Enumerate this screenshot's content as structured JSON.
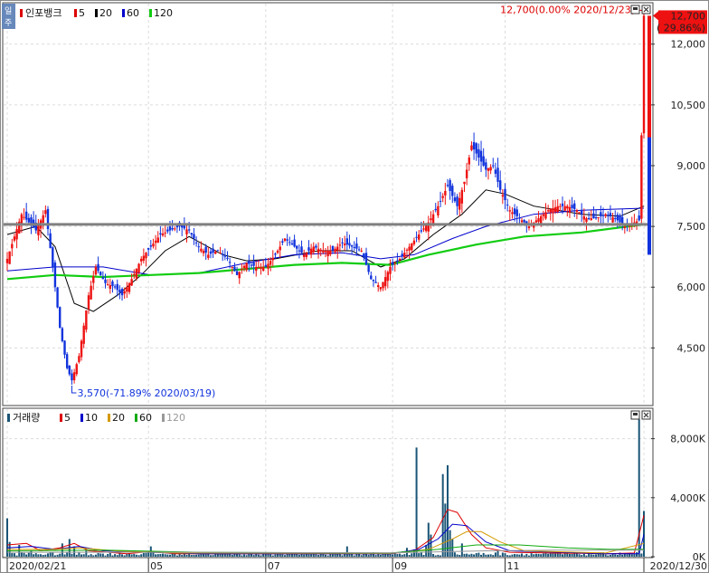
{
  "chart_data": [
    {
      "type": "candlestick",
      "legend": {
        "name": "인포뱅크",
        "items": [
          {
            "label": "5",
            "color": "#dd0000"
          },
          {
            "label": "20",
            "color": "#000000"
          },
          {
            "label": "60",
            "color": "#0000cc"
          },
          {
            "label": "120",
            "color": "#11cc11"
          }
        ]
      },
      "y_ticks": [
        "12,000",
        "10,500",
        "9,000",
        "7,500",
        "6,000",
        "4,500"
      ],
      "y_tick_values": [
        12000,
        10500,
        9000,
        7500,
        6000,
        4500
      ],
      "ylim": [
        3100,
        13000
      ],
      "reference_level": 7550,
      "last_price": {
        "price": "12,700",
        "change": "( 29.86%)",
        "value": 12700
      },
      "high_annotation": {
        "text": "12,700(0.00% 2020/12/23)",
        "value": 12700
      },
      "low_annotation": {
        "text": "3,570(-71.89% 2020/03/19)",
        "value": 3570
      },
      "right_bar": {
        "red": [
          7700,
          12700
        ],
        "blue": [
          6800,
          9700
        ]
      },
      "ohlc_path": [
        {
          "i": 0,
          "c": 6700
        },
        {
          "i": 6,
          "c": 7800
        },
        {
          "i": 12,
          "c": 7400
        },
        {
          "i": 16,
          "c": 7900
        },
        {
          "i": 19,
          "c": 6500
        },
        {
          "i": 22,
          "c": 5000
        },
        {
          "i": 25,
          "c": 4000
        },
        {
          "i": 27,
          "c": 3700
        },
        {
          "i": 30,
          "c": 4300
        },
        {
          "i": 34,
          "c": 5800
        },
        {
          "i": 37,
          "c": 6500
        },
        {
          "i": 41,
          "c": 6100
        },
        {
          "i": 45,
          "c": 6000
        },
        {
          "i": 48,
          "c": 5800
        },
        {
          "i": 52,
          "c": 6200
        },
        {
          "i": 56,
          "c": 6700
        },
        {
          "i": 60,
          "c": 7000
        },
        {
          "i": 64,
          "c": 7300
        },
        {
          "i": 68,
          "c": 7400
        },
        {
          "i": 72,
          "c": 7500
        },
        {
          "i": 76,
          "c": 7400
        },
        {
          "i": 80,
          "c": 7000
        },
        {
          "i": 84,
          "c": 6800
        },
        {
          "i": 88,
          "c": 6900
        },
        {
          "i": 92,
          "c": 6700
        },
        {
          "i": 96,
          "c": 6300
        },
        {
          "i": 100,
          "c": 6600
        },
        {
          "i": 104,
          "c": 6500
        },
        {
          "i": 108,
          "c": 6500
        },
        {
          "i": 112,
          "c": 6800
        },
        {
          "i": 116,
          "c": 7200
        },
        {
          "i": 120,
          "c": 7000
        },
        {
          "i": 124,
          "c": 6800
        },
        {
          "i": 128,
          "c": 7000
        },
        {
          "i": 132,
          "c": 6900
        },
        {
          "i": 136,
          "c": 6900
        },
        {
          "i": 140,
          "c": 7100
        },
        {
          "i": 144,
          "c": 7000
        },
        {
          "i": 148,
          "c": 6900
        },
        {
          "i": 152,
          "c": 6200
        },
        {
          "i": 156,
          "c": 6000
        },
        {
          "i": 160,
          "c": 6500
        },
        {
          "i": 164,
          "c": 6700
        },
        {
          "i": 168,
          "c": 7000
        },
        {
          "i": 172,
          "c": 7300
        },
        {
          "i": 176,
          "c": 7600
        },
        {
          "i": 180,
          "c": 8000
        },
        {
          "i": 184,
          "c": 8500
        },
        {
          "i": 188,
          "c": 8000
        },
        {
          "i": 191,
          "c": 8600
        },
        {
          "i": 194,
          "c": 9500
        },
        {
          "i": 197,
          "c": 9200
        },
        {
          "i": 200,
          "c": 8900
        },
        {
          "i": 203,
          "c": 9000
        },
        {
          "i": 206,
          "c": 8400
        },
        {
          "i": 210,
          "c": 7900
        },
        {
          "i": 214,
          "c": 7700
        },
        {
          "i": 218,
          "c": 7500
        },
        {
          "i": 222,
          "c": 7700
        },
        {
          "i": 226,
          "c": 7900
        },
        {
          "i": 230,
          "c": 8000
        },
        {
          "i": 234,
          "c": 8000
        },
        {
          "i": 238,
          "c": 7900
        },
        {
          "i": 242,
          "c": 7700
        },
        {
          "i": 246,
          "c": 7700
        },
        {
          "i": 250,
          "c": 7800
        },
        {
          "i": 254,
          "c": 7700
        },
        {
          "i": 258,
          "c": 7500
        },
        {
          "i": 262,
          "c": 7600
        },
        {
          "i": 264,
          "c": 7650
        },
        {
          "i": 265,
          "c": 9750
        },
        {
          "i": 266,
          "c": 12700
        }
      ],
      "ma_lines": [
        {
          "name": "20",
          "color": "#000000",
          "points": [
            [
              0,
              7300
            ],
            [
              12,
              7500
            ],
            [
              20,
              7000
            ],
            [
              28,
              5600
            ],
            [
              36,
              5400
            ],
            [
              46,
              5800
            ],
            [
              56,
              6300
            ],
            [
              66,
              6900
            ],
            [
              76,
              7250
            ],
            [
              90,
              6800
            ],
            [
              100,
              6650
            ],
            [
              112,
              6700
            ],
            [
              130,
              6900
            ],
            [
              144,
              6900
            ],
            [
              156,
              6500
            ],
            [
              166,
              6700
            ],
            [
              178,
              7300
            ],
            [
              190,
              7800
            ],
            [
              200,
              8400
            ],
            [
              208,
              8300
            ],
            [
              220,
              8000
            ],
            [
              240,
              7800
            ],
            [
              256,
              7750
            ],
            [
              266,
              8000
            ]
          ]
        },
        {
          "name": "60",
          "color": "#0000cc",
          "points": [
            [
              0,
              6400
            ],
            [
              20,
              6500
            ],
            [
              40,
              6500
            ],
            [
              60,
              6300
            ],
            [
              80,
              6350
            ],
            [
              100,
              6600
            ],
            [
              120,
              6800
            ],
            [
              140,
              6850
            ],
            [
              156,
              6700
            ],
            [
              170,
              6800
            ],
            [
              186,
              7200
            ],
            [
              200,
              7500
            ],
            [
              220,
              7800
            ],
            [
              240,
              7900
            ],
            [
              266,
              7950
            ]
          ]
        },
        {
          "name": "120",
          "color": "#11cc11",
          "points": [
            [
              0,
              6200
            ],
            [
              20,
              6300
            ],
            [
              40,
              6250
            ],
            [
              60,
              6300
            ],
            [
              80,
              6350
            ],
            [
              100,
              6450
            ],
            [
              120,
              6550
            ],
            [
              140,
              6600
            ],
            [
              160,
              6550
            ],
            [
              176,
              6800
            ],
            [
              196,
              7050
            ],
            [
              216,
              7250
            ],
            [
              240,
              7350
            ],
            [
              266,
              7550
            ]
          ]
        }
      ]
    },
    {
      "type": "bar",
      "legend": {
        "name": "거래량",
        "items": [
          {
            "label": "5",
            "color": "#dd0000"
          },
          {
            "label": "10",
            "color": "#0000cc"
          },
          {
            "label": "20",
            "color": "#d49a00"
          },
          {
            "label": "60",
            "color": "#11aa11"
          },
          {
            "label": "120",
            "color": "#999999"
          }
        ]
      },
      "y_ticks": [
        "8,000K",
        "4,000K",
        "0K"
      ],
      "y_tick_values": [
        8000,
        4000,
        0
      ],
      "ylim": [
        0,
        10000
      ],
      "x_ticks": [
        "2020/02/21",
        "05",
        "07",
        "09",
        "11",
        "2020/12/30"
      ],
      "x_tick_index": [
        0,
        59,
        108,
        161,
        208,
        266
      ],
      "volume_spikes": [
        {
          "i": 0,
          "v": 2600
        },
        {
          "i": 1,
          "v": 1000
        },
        {
          "i": 5,
          "v": 800
        },
        {
          "i": 10,
          "v": 400
        },
        {
          "i": 23,
          "v": 900
        },
        {
          "i": 26,
          "v": 1200
        },
        {
          "i": 28,
          "v": 700
        },
        {
          "i": 33,
          "v": 400
        },
        {
          "i": 60,
          "v": 700
        },
        {
          "i": 61,
          "v": 400
        },
        {
          "i": 108,
          "v": 300
        },
        {
          "i": 142,
          "v": 700
        },
        {
          "i": 153,
          "v": 300
        },
        {
          "i": 167,
          "v": 600
        },
        {
          "i": 170,
          "v": 500
        },
        {
          "i": 171,
          "v": 7400
        },
        {
          "i": 175,
          "v": 800
        },
        {
          "i": 176,
          "v": 2300
        },
        {
          "i": 177,
          "v": 1500
        },
        {
          "i": 182,
          "v": 5600
        },
        {
          "i": 183,
          "v": 3600
        },
        {
          "i": 184,
          "v": 6200
        },
        {
          "i": 185,
          "v": 1800
        },
        {
          "i": 186,
          "v": 1200
        },
        {
          "i": 190,
          "v": 900
        },
        {
          "i": 205,
          "v": 400
        },
        {
          "i": 263,
          "v": 300
        },
        {
          "i": 264,
          "v": 9300
        },
        {
          "i": 266,
          "v": 3100
        }
      ],
      "volume_ma_lines": [
        {
          "name": "5",
          "color": "#dd0000",
          "points": [
            [
              0,
              800
            ],
            [
              8,
              900
            ],
            [
              14,
              400
            ],
            [
              22,
              600
            ],
            [
              28,
              900
            ],
            [
              34,
              400
            ],
            [
              50,
              200
            ],
            [
              60,
              350
            ],
            [
              70,
              200
            ],
            [
              120,
              200
            ],
            [
              160,
              200
            ],
            [
              170,
              400
            ],
            [
              178,
              1300
            ],
            [
              184,
              3200
            ],
            [
              188,
              3000
            ],
            [
              194,
              1500
            ],
            [
              200,
              600
            ],
            [
              210,
              300
            ],
            [
              250,
              200
            ],
            [
              262,
              250
            ],
            [
              266,
              2800
            ]
          ]
        },
        {
          "name": "10",
          "color": "#0000cc",
          "points": [
            [
              0,
              600
            ],
            [
              10,
              700
            ],
            [
              20,
              500
            ],
            [
              30,
              700
            ],
            [
              40,
              400
            ],
            [
              60,
              300
            ],
            [
              80,
              200
            ],
            [
              160,
              200
            ],
            [
              172,
              500
            ],
            [
              180,
              1200
            ],
            [
              186,
              2200
            ],
            [
              192,
              2100
            ],
            [
              200,
              1000
            ],
            [
              210,
              400
            ],
            [
              250,
              200
            ],
            [
              264,
              200
            ],
            [
              266,
              1500
            ]
          ]
        },
        {
          "name": "20",
          "color": "#d49a00",
          "points": [
            [
              0,
              500
            ],
            [
              20,
              500
            ],
            [
              30,
              600
            ],
            [
              45,
              400
            ],
            [
              70,
              250
            ],
            [
              160,
              220
            ],
            [
              176,
              500
            ],
            [
              186,
              1200
            ],
            [
              192,
              1700
            ],
            [
              198,
              1700
            ],
            [
              206,
              1000
            ],
            [
              216,
              400
            ],
            [
              250,
              250
            ],
            [
              266,
              900
            ]
          ]
        },
        {
          "name": "60",
          "color": "#11aa11",
          "points": [
            [
              0,
              400
            ],
            [
              40,
              450
            ],
            [
              80,
              300
            ],
            [
              160,
              250
            ],
            [
              180,
              500
            ],
            [
              196,
              800
            ],
            [
              214,
              800
            ],
            [
              234,
              600
            ],
            [
              252,
              500
            ],
            [
              266,
              500
            ]
          ]
        },
        {
          "name": "120",
          "color": "#999999",
          "points": [
            [
              0,
              300
            ],
            [
              80,
              300
            ],
            [
              160,
              260
            ],
            [
              200,
              400
            ],
            [
              230,
              450
            ],
            [
              266,
              450
            ]
          ]
        }
      ]
    }
  ]
}
